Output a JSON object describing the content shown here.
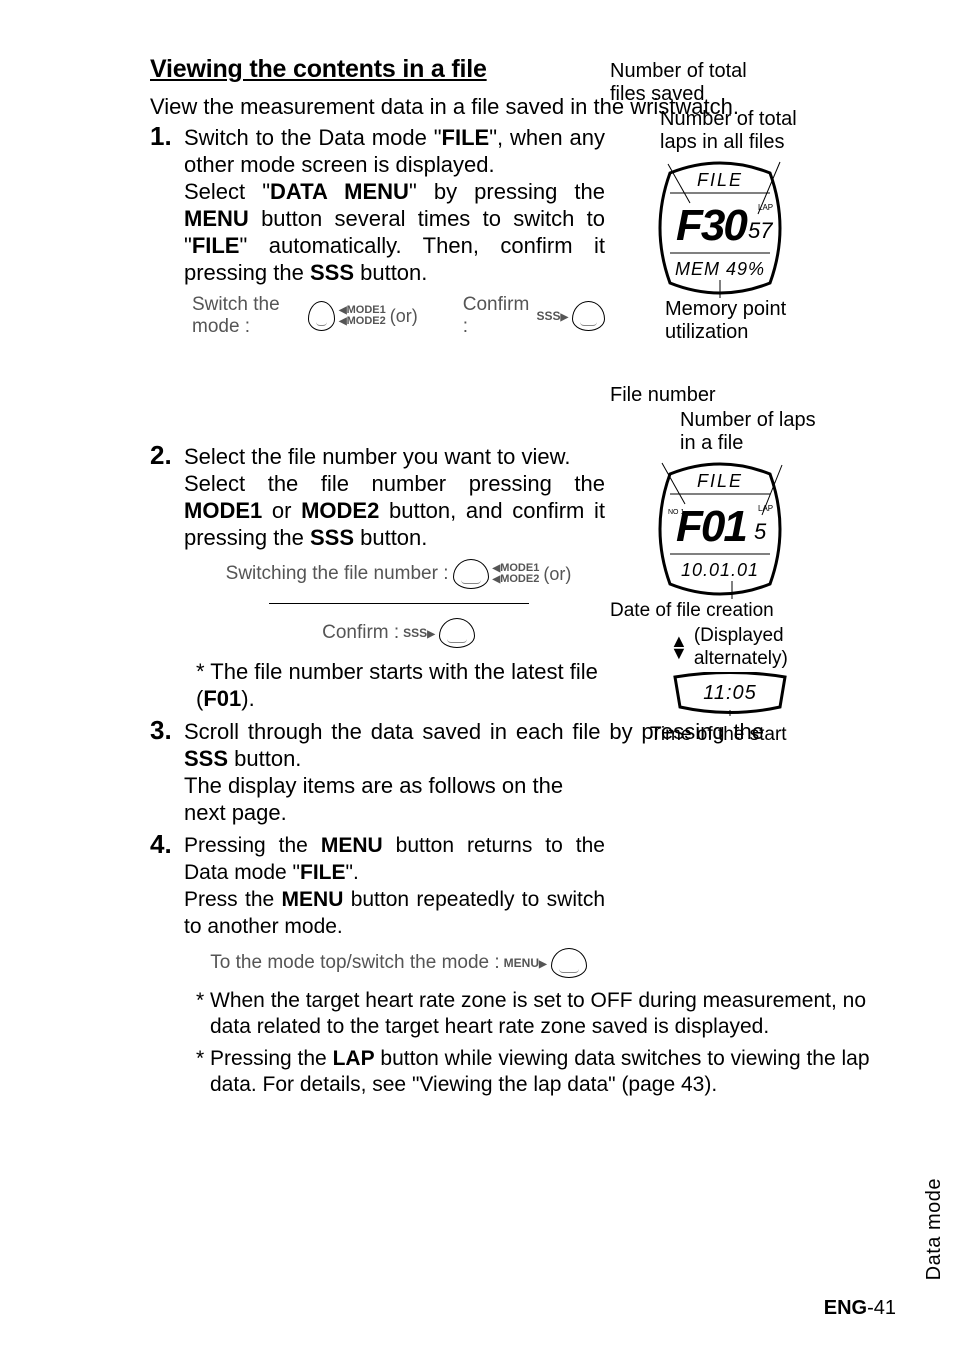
{
  "section_title": "Viewing the contents in a file",
  "intro": "View the measurement data in a file saved in the wristwatch.",
  "steps": {
    "s1": {
      "num": "1.",
      "p1_pre": "Switch to the Data mode \"",
      "p1_b1": "FILE",
      "p1_mid": "\", when any other mode screen is displayed.",
      "p2_a": "Select \"",
      "p2_b1": "DATA MENU",
      "p2_b": "\" by pressing the ",
      "p2_b2": "MENU",
      "p2_c": " button several times to switch to \"",
      "p2_b3": "FILE",
      "p2_d": "\" automatically. Then, confirm it pressing the ",
      "p2_b4": "SSS",
      "p2_e": " button.",
      "sw_label": "Switch the mode :",
      "cf_label": "Confirm :",
      "mode1": "MODE1",
      "mode2": "MODE2",
      "or": " (or)",
      "sss": "SSS"
    },
    "s2": {
      "num": "2.",
      "p1": "Select the file number you want to view.",
      "p2_a": "Select the file number pressing the ",
      "p2_b1": "MODE1",
      "p2_b": " or ",
      "p2_b2": "MODE2",
      "p2_c": " button, and confirm it pressing the ",
      "p2_b3": "SSS",
      "p2_d": " button.",
      "swf_label": "Switching the file number :",
      "cf_label": "Confirm :",
      "note_a": "* The file number starts with the latest file (",
      "note_b": "F01",
      "note_c": ")."
    },
    "s3": {
      "num": "3.",
      "p1_a": "Scroll through the data saved in each file by pressing the ",
      "p1_b": "SSS",
      "p1_c": " button.",
      "p2": "The display items are as follows on the next page."
    },
    "s4": {
      "num": "4.",
      "p1_a": "Pressing the ",
      "p1_b": "MENU",
      "p1_c": " button returns to the Data mode \"",
      "p1_d": "FILE",
      "p1_e": "\".",
      "p2_a": "Press the ",
      "p2_b": "MENU",
      "p2_c": " button repeatedly to switch to another mode.",
      "btn_label": "To the mode top/switch the mode :",
      "menu": "MENU"
    }
  },
  "footnotes": {
    "f1": "* When the target heart rate zone is set to OFF during measurement, no data related to the target heart rate zone saved is displayed.",
    "f2_a": "* Pressing the ",
    "f2_b": "LAP",
    "f2_c": " button while viewing data switches to viewing the lap data. For details, see \"Viewing the lap data\" (page 43)."
  },
  "right": {
    "ntotal_files": "Number of total files saved",
    "ntotal_laps": "Number of total laps in all files",
    "mem_util": "Memory point utilization",
    "file_number": "File number",
    "laps_in_file": "Number of laps in a file",
    "date_creation": "Date of file creation",
    "displayed_alt": "(Displayed alternately)",
    "time_start": "Time of the start",
    "w1_top": "FILE",
    "w1_main": "F30",
    "w1_side": "57",
    "w1_lap": "LAP",
    "w1_bot": "MEM 49%",
    "w2_top": "FILE",
    "w2_main": "F01",
    "w2_side": "5",
    "w2_lap": "LAP",
    "w2_bot": "10.01.01",
    "w2_no": "NO 1",
    "w3_time": "11:05"
  },
  "sidetab": "Data mode",
  "pagenum_prefix": "ENG",
  "pagenum_no": "-41"
}
